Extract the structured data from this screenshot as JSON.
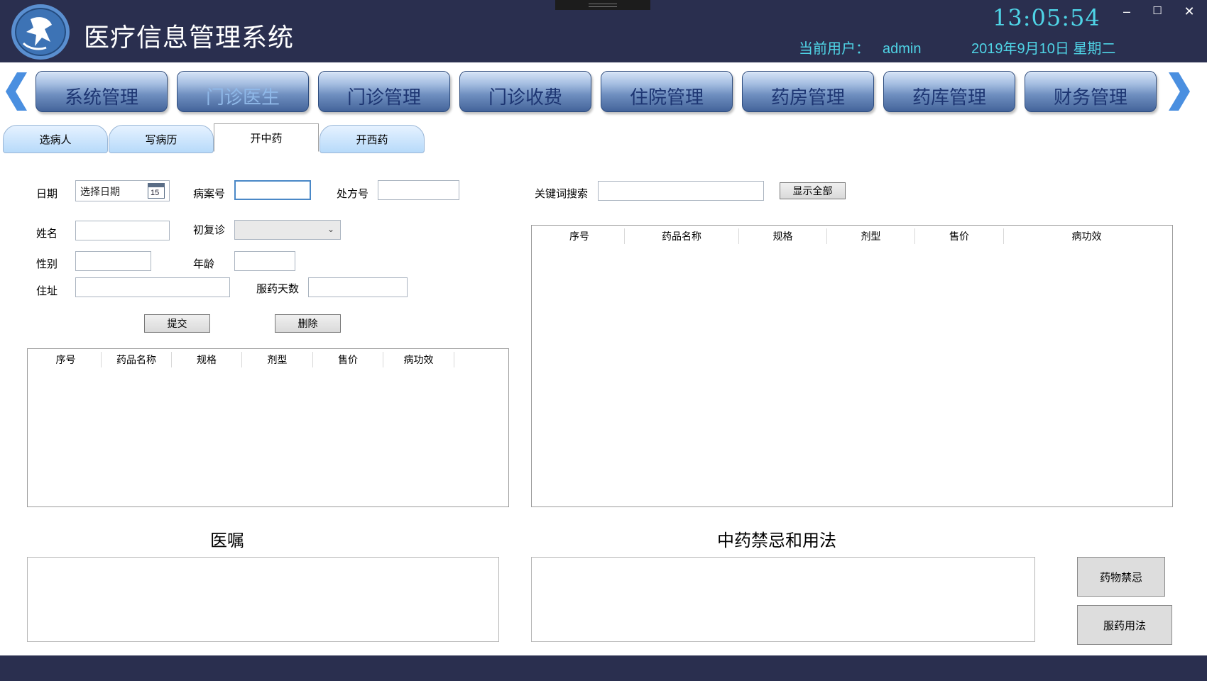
{
  "header": {
    "app_title": "医疗信息管理系统",
    "clock": "13:05:54",
    "user_label": "当前用户：",
    "user_name": "admin",
    "date": "2019年9月10日 星期二",
    "minimize": "–",
    "maximize": "☐",
    "close": "✕"
  },
  "nav": {
    "modules": [
      {
        "label": "系统管理",
        "active": false
      },
      {
        "label": "门诊医生",
        "active": true
      },
      {
        "label": "门诊管理",
        "active": false
      },
      {
        "label": "门诊收费",
        "active": false
      },
      {
        "label": "住院管理",
        "active": false
      },
      {
        "label": "药房管理",
        "active": false
      },
      {
        "label": "药库管理",
        "active": false
      },
      {
        "label": "财务管理",
        "active": false
      }
    ]
  },
  "subtabs": [
    {
      "label": "选病人",
      "active": false
    },
    {
      "label": "写病历",
      "active": false
    },
    {
      "label": "开中药",
      "active": true
    },
    {
      "label": "开西药",
      "active": false
    }
  ],
  "form": {
    "date_label": "日期",
    "date_placeholder": "选择日期",
    "calendar_day": "15",
    "case_no_label": "病案号",
    "case_no_value": "",
    "rx_no_label": "处方号",
    "rx_no_value": "",
    "name_label": "姓名",
    "name_value": "",
    "visit_type_label": "初复诊",
    "visit_type_value": "",
    "gender_label": "性别",
    "gender_value": "",
    "age_label": "年龄",
    "age_value": "",
    "address_label": "住址",
    "address_value": "",
    "days_label": "服药天数",
    "days_value": "",
    "submit_label": "提交",
    "delete_label": "删除"
  },
  "rx_table": {
    "columns": [
      "序号",
      "药品名称",
      "规格",
      "剂型",
      "售价",
      "病功效"
    ],
    "rows": []
  },
  "search": {
    "keyword_label": "关键词搜索",
    "keyword_value": "",
    "show_all_label": "显示全部"
  },
  "drug_table": {
    "columns": [
      "序号",
      "药品名称",
      "规格",
      "剂型",
      "售价",
      "病功效"
    ],
    "rows": []
  },
  "advice": {
    "title": "医嘱",
    "value": ""
  },
  "tcm": {
    "title": "中药禁忌和用法",
    "value": "",
    "contraindication_label": "药物禁忌",
    "usage_label": "服药用法"
  },
  "colors": {
    "header_bg": "#2a2f4f",
    "accent_cyan": "#4fd4e6",
    "nav_text": "#1d3572",
    "nav_active_text": "#8fb8e8",
    "arrow": "#4a8fe0"
  }
}
